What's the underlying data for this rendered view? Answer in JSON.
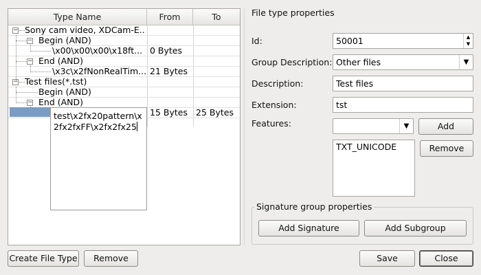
{
  "tree": {
    "columns": [
      "Type Name",
      "From",
      "To"
    ],
    "rows": [
      {
        "name": "Sony cam video, XDCam-E...",
        "from": "",
        "to": ""
      },
      {
        "name": "Begin (AND)",
        "from": "",
        "to": ""
      },
      {
        "name": "\\x00\\x00\\x00\\x18ft...",
        "from": "0 Bytes",
        "to": ""
      },
      {
        "name": "End (AND)",
        "from": "",
        "to": ""
      },
      {
        "name": "\\x3c\\x2fNonRealTim...",
        "from": "21 Bytes",
        "to": ""
      },
      {
        "name": "Test files(*.tst)",
        "from": "",
        "to": ""
      },
      {
        "name": "Begin (AND)",
        "from": "",
        "to": ""
      },
      {
        "name": "End (AND)",
        "from": "",
        "to": ""
      },
      {
        "name": "",
        "from": "15 Bytes",
        "to": "25 Bytes"
      }
    ],
    "editor_text": "test\\x2fx20pattern\\x2fx2fxFF\\x2fx2fx25"
  },
  "buttons": {
    "create_file_type": "Create File Type",
    "remove_left": "Remove",
    "add_feature": "Add",
    "remove_feature": "Remove",
    "add_signature": "Add Signature",
    "add_subgroup": "Add Subgroup",
    "save": "Save",
    "close": "Close"
  },
  "props": {
    "title": "File type properties",
    "id_label": "Id:",
    "id_value": "50001",
    "group_desc_label": "Group Description:",
    "group_desc_value": "Other files",
    "description_label": "Description:",
    "description_value": "Test files",
    "extension_label": "Extension:",
    "extension_value": "tst",
    "features_label": "Features:",
    "features_value": "",
    "features_list": [
      "TXT_UNICODE"
    ],
    "signature_group_title": "Signature group properties"
  }
}
